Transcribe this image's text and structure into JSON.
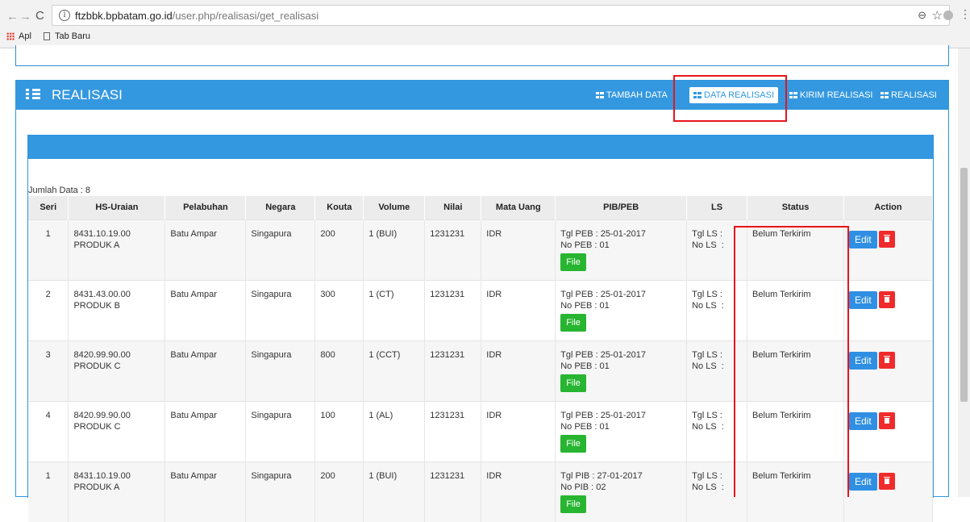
{
  "browser": {
    "url_host": "ftzbbk.bpbatam.go.id",
    "url_path": "/user.php/realisasi/get_realisasi",
    "bookmarks": [
      "Apl",
      "Tab Baru"
    ]
  },
  "panel": {
    "title": "REALISASI",
    "nav": [
      "TAMBAH DATA",
      "DATA REALISASI",
      "KIRIM REALISASI",
      "REALISASI"
    ],
    "active_nav": "DATA REALISASI"
  },
  "jumlah": "Jumlah Data : 8",
  "table": {
    "headers": [
      "Seri",
      "HS-Uraian",
      "Pelabuhan",
      "Negara",
      "Kouta",
      "Volume",
      "Nilai",
      "Mata Uang",
      "PIB/PEB",
      "LS",
      "Status",
      "Action"
    ],
    "rows": [
      {
        "seri": "1",
        "hs": "8431.10.19.00",
        "uraian": "PRODUK A",
        "pelabuhan": "Batu Ampar",
        "negara": "Singapura",
        "kouta": "200",
        "volume": "1 (BUI)",
        "nilai": "1231231",
        "mata_uang": "IDR",
        "pib_tgl": "Tgl PEB : 25-01-2017",
        "pib_no": "No PEB : 01",
        "ls_tgl": "Tgl LS :",
        "ls_no": "No LS  :",
        "status": "Belum Terkirim"
      },
      {
        "seri": "2",
        "hs": "8431.43.00.00",
        "uraian": "PRODUK B",
        "pelabuhan": "Batu Ampar",
        "negara": "Singapura",
        "kouta": "300",
        "volume": "1 (CT)",
        "nilai": "1231231",
        "mata_uang": "IDR",
        "pib_tgl": "Tgl PEB : 25-01-2017",
        "pib_no": "No PEB : 01",
        "ls_tgl": "Tgl LS :",
        "ls_no": "No LS  :",
        "status": "Belum Terkirim"
      },
      {
        "seri": "3",
        "hs": "8420.99.90.00",
        "uraian": "PRODUK C",
        "pelabuhan": "Batu Ampar",
        "negara": "Singapura",
        "kouta": "800",
        "volume": "1 (CCT)",
        "nilai": "1231231",
        "mata_uang": "IDR",
        "pib_tgl": "Tgl PEB : 25-01-2017",
        "pib_no": "No PEB : 01",
        "ls_tgl": "Tgl LS :",
        "ls_no": "No LS  :",
        "status": "Belum Terkirim"
      },
      {
        "seri": "4",
        "hs": "8420.99.90.00",
        "uraian": "PRODUK C",
        "pelabuhan": "Batu Ampar",
        "negara": "Singapura",
        "kouta": "100",
        "volume": "1 (AL)",
        "nilai": "1231231",
        "mata_uang": "IDR",
        "pib_tgl": "Tgl PEB : 25-01-2017",
        "pib_no": "No PEB : 01",
        "ls_tgl": "Tgl LS :",
        "ls_no": "No LS  :",
        "status": "Belum Terkirim"
      },
      {
        "seri": "1",
        "hs": "8431.10.19.00",
        "uraian": "PRODUK A",
        "pelabuhan": "Batu Ampar",
        "negara": "Singapura",
        "kouta": "200",
        "volume": "1 (BUI)",
        "nilai": "1231231",
        "mata_uang": "IDR",
        "pib_tgl": "Tgl PIB : 27-01-2017",
        "pib_no": "No PIB : 02",
        "ls_tgl": "Tgl LS :",
        "ls_no": "No LS  :",
        "status": "Belum Terkirim"
      }
    ],
    "file_label": "File",
    "edit_label": "Edit"
  },
  "colors": {
    "header_blue": "#3498e0",
    "file_green": "#28b531",
    "edit_blue": "#2f8fe3",
    "delete_red": "#ef2b2b",
    "highlight_red": "#e8141a"
  }
}
